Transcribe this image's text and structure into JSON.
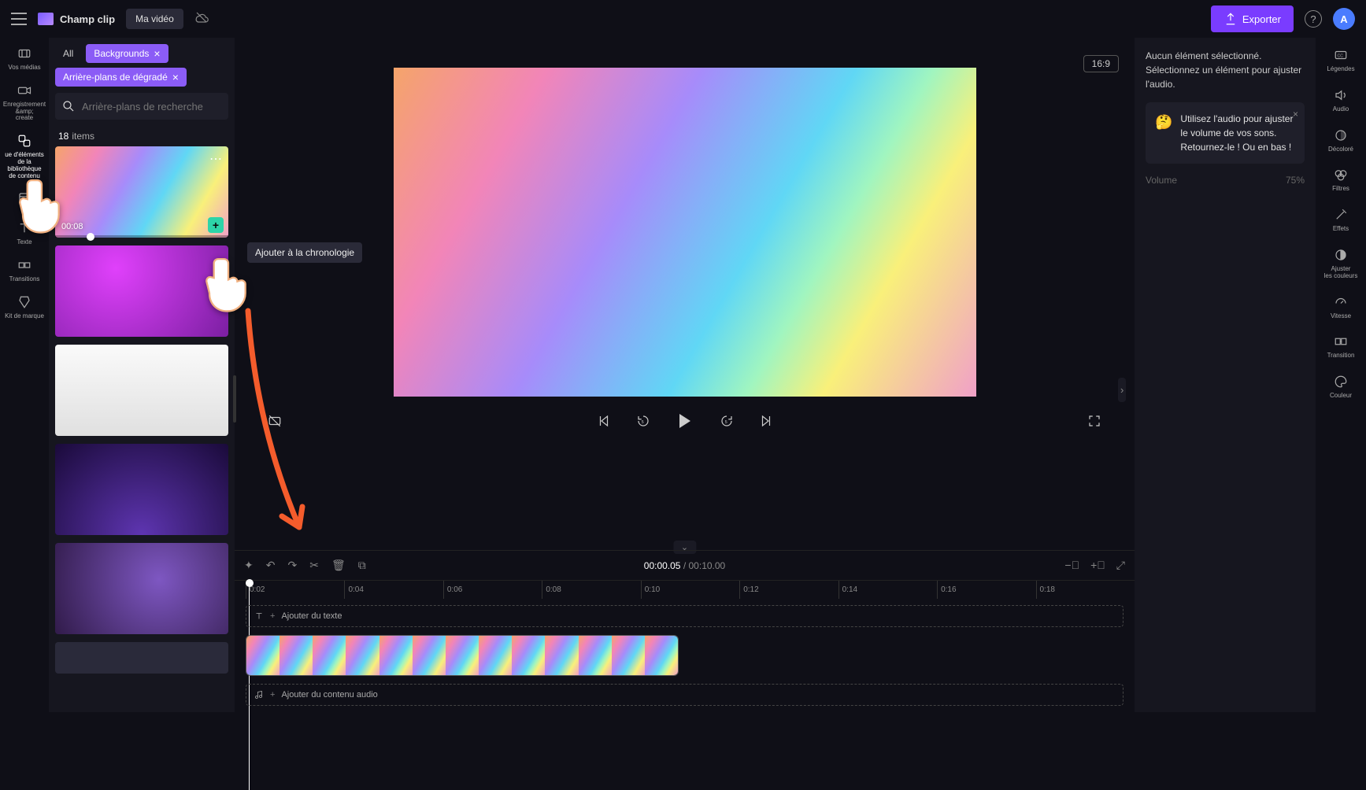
{
  "header": {
    "app_name": "Champ clip",
    "video_title": "Ma vidéo",
    "export_label": "Exporter",
    "avatar_letter": "A"
  },
  "left_nav": {
    "items": [
      {
        "label": "Vos médias"
      },
      {
        "label": "Enregistrement &amp;\ncreate"
      },
      {
        "label": "ue d'éléments de la bibliothèque\nde contenu"
      },
      {
        "label": ""
      },
      {
        "label": "Texte"
      },
      {
        "label": "Transitions"
      },
      {
        "label": "Kit de marque"
      }
    ]
  },
  "media_panel": {
    "chips": {
      "all": "All",
      "backgrounds": "Backgrounds",
      "gradient": "Arrière-plans de dégradé"
    },
    "search_placeholder": "Arrière-plans de recherche",
    "item_count_num": "18",
    "item_count_label": "items",
    "first_item_duration": "00:08",
    "tooltip_add": "Ajouter à la chronologie"
  },
  "preview": {
    "aspect": "16:9"
  },
  "timeline": {
    "current_time": "00:00.05",
    "total_time": "00:10.00",
    "ruler_marks": [
      "0:02",
      "0:04",
      "0:06",
      "0:08",
      "0:10",
      "0:12",
      "0:14",
      "0:16",
      "0:18"
    ],
    "add_text_label": "Ajouter du texte",
    "add_audio_label": "Ajouter du contenu audio"
  },
  "right_panel": {
    "msg": "Aucun élément sélectionné. Sélectionnez un élément pour ajuster l'audio.",
    "tip": "Utilisez l'audio pour ajuster le volume de vos sons. Retournez-le ! Ou en bas !",
    "volume_label": "Volume",
    "volume_value": "75%"
  },
  "right_rail": {
    "items": [
      {
        "label": "Légendes"
      },
      {
        "label": "Audio"
      },
      {
        "label": "Décoloré"
      },
      {
        "label": "Filtres"
      },
      {
        "label": "Effets"
      },
      {
        "label": "Ajuster\nles couleurs"
      },
      {
        "label": "Vitesse"
      },
      {
        "label": "Transition"
      },
      {
        "label": "Couleur"
      }
    ]
  }
}
